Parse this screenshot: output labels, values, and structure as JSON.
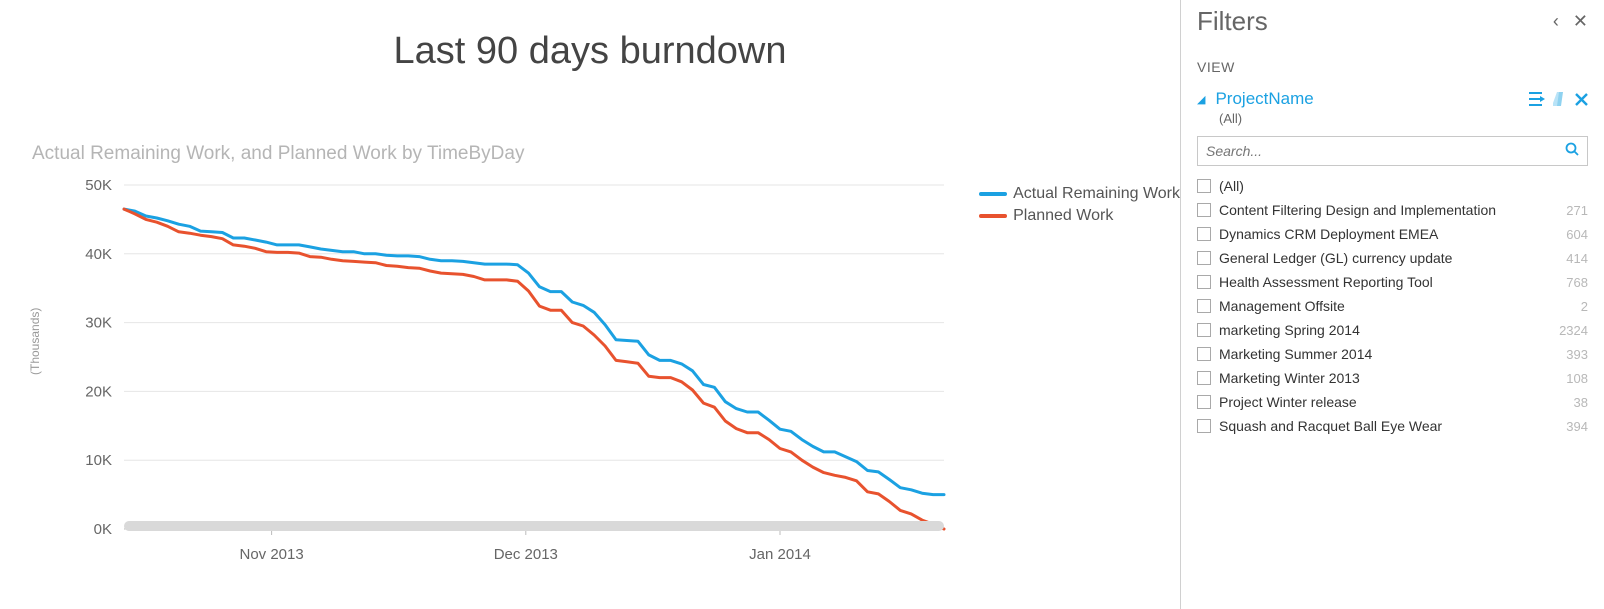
{
  "chart_data": {
    "type": "line",
    "title": "Last 90 days burndown",
    "subtitle": "Actual Remaining Work, and Planned Work by TimeByDay",
    "ylabel": "(Thousands)",
    "ylim": [
      0,
      50000
    ],
    "y_ticks": [
      "50K",
      "40K",
      "30K",
      "20K",
      "10K",
      "0K"
    ],
    "x_ticks": [
      "Nov 2013",
      "Dec 2013",
      "Jan 2014"
    ],
    "series": [
      {
        "name": "Actual Remaining Work",
        "color": "#1ba1e2",
        "values": [
          46500,
          46200,
          45500,
          45200,
          44800,
          44300,
          44000,
          43300,
          43200,
          43100,
          42300,
          42300,
          42000,
          41700,
          41300,
          41300,
          41300,
          41000,
          40700,
          40500,
          40300,
          40300,
          40000,
          40000,
          39800,
          39700,
          39700,
          39600,
          39200,
          39000,
          39000,
          38900,
          38700,
          38500,
          38500,
          38500,
          38400,
          37200,
          35200,
          34500,
          34500,
          33000,
          32500,
          31500,
          29700,
          27500,
          27400,
          27300,
          25300,
          24500,
          24500,
          24000,
          23000,
          21000,
          20600,
          18500,
          17500,
          17000,
          17000,
          15800,
          14500,
          14200,
          13000,
          12000,
          11200,
          11200,
          10500,
          9800,
          8500,
          8300,
          7200,
          6000,
          5700,
          5200,
          5000,
          5000
        ]
      },
      {
        "name": "Planned Work",
        "color": "#e8522e",
        "values": [
          46500,
          45800,
          45000,
          44600,
          44000,
          43200,
          43000,
          42700,
          42500,
          42200,
          41300,
          41100,
          40800,
          40300,
          40200,
          40200,
          40100,
          39600,
          39500,
          39200,
          39000,
          38900,
          38800,
          38700,
          38300,
          38200,
          38000,
          37900,
          37500,
          37200,
          37100,
          37000,
          36700,
          36200,
          36200,
          36200,
          36000,
          34600,
          32400,
          31800,
          31800,
          30000,
          29500,
          28200,
          26600,
          24500,
          24300,
          24100,
          22200,
          22000,
          22000,
          21400,
          20200,
          18300,
          17700,
          15700,
          14600,
          14000,
          14000,
          13000,
          11700,
          11200,
          10000,
          9000,
          8200,
          7800,
          7500,
          7000,
          5400,
          5100,
          4000,
          2700,
          2200,
          1300,
          700,
          0
        ]
      }
    ]
  },
  "legend": {
    "actual": "Actual Remaining Work",
    "planned": "Planned Work"
  },
  "filters": {
    "panel_title": "Filters",
    "view_label": "VIEW",
    "field_name": "ProjectName",
    "field_summary": "(All)",
    "search_placeholder": "Search...",
    "options": [
      {
        "label": "(All)",
        "count": ""
      },
      {
        "label": "Content Filtering Design and Implementation",
        "count": "271"
      },
      {
        "label": "Dynamics CRM Deployment EMEA",
        "count": "604"
      },
      {
        "label": "General Ledger (GL) currency update",
        "count": "414"
      },
      {
        "label": "Health Assessment Reporting Tool",
        "count": "768"
      },
      {
        "label": "Management Offsite",
        "count": "2"
      },
      {
        "label": "marketing Spring 2014",
        "count": "2324"
      },
      {
        "label": "Marketing Summer 2014",
        "count": "393"
      },
      {
        "label": "Marketing Winter 2013",
        "count": "108"
      },
      {
        "label": "Project Winter release",
        "count": "38"
      },
      {
        "label": "Squash and Racquet Ball Eye Wear",
        "count": "394"
      }
    ]
  }
}
